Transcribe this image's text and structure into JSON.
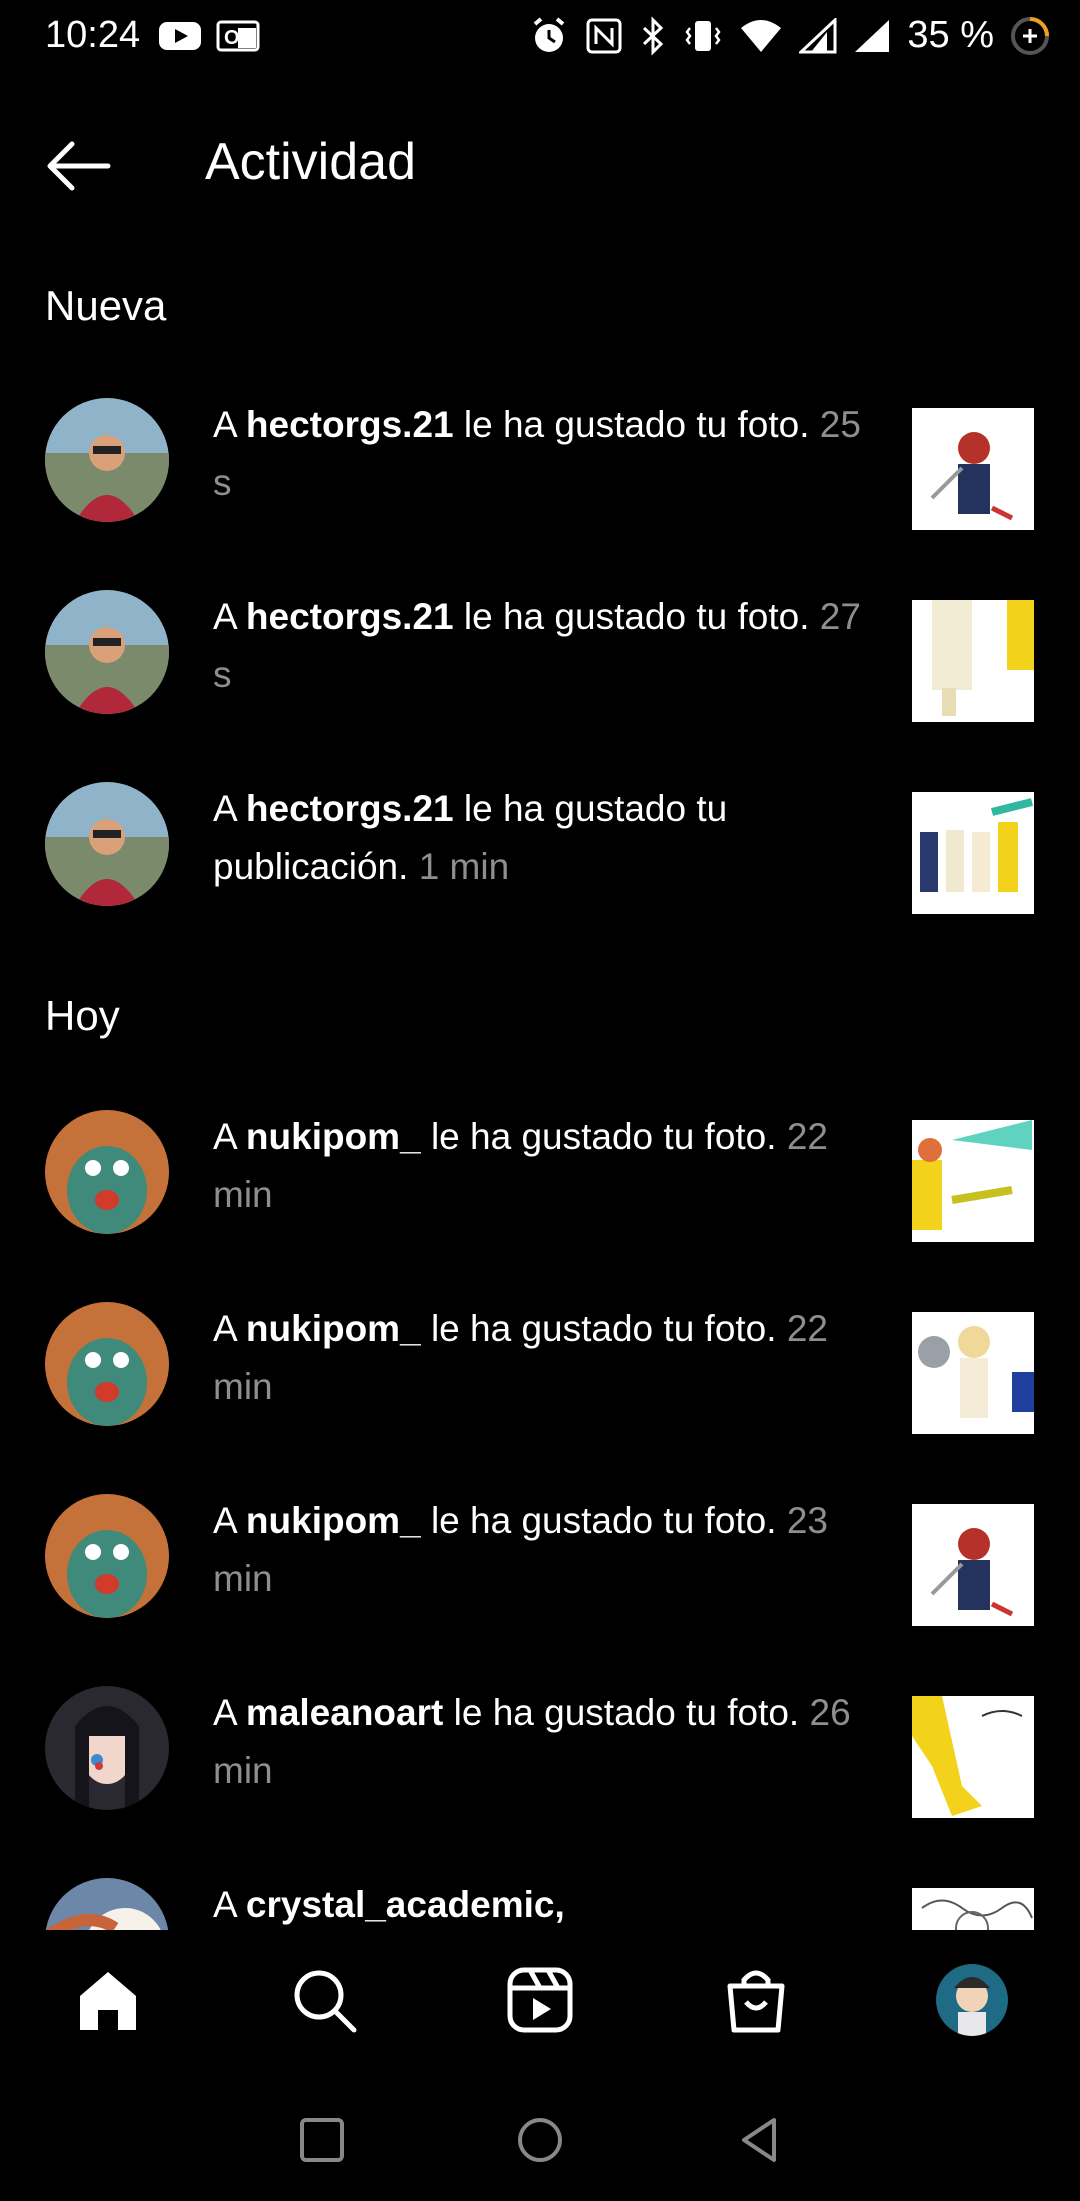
{
  "status_bar": {
    "time": "10:24",
    "battery": "35 %"
  },
  "header": {
    "title": "Actividad"
  },
  "sections": {
    "new": "Nueva",
    "today": "Hoy"
  },
  "notifications": [
    {
      "pre": "A ",
      "user": "hectorgs.21",
      "text": " le ha gustado tu foto. ",
      "time": "25 s"
    },
    {
      "pre": "A ",
      "user": "hectorgs.21",
      "text": " le ha gustado tu foto. ",
      "time": "27 s"
    },
    {
      "pre": "A ",
      "user": "hectorgs.21",
      "text": " le ha gustado tu publicación. ",
      "time": "1 min"
    },
    {
      "pre": "A ",
      "user": "nukipom_",
      "text": " le ha gustado tu foto. ",
      "time": "22 min"
    },
    {
      "pre": "A ",
      "user": "nukipom_",
      "text": " le ha gustado tu foto. ",
      "time": "22 min"
    },
    {
      "pre": "A ",
      "user": "nukipom_",
      "text": " le ha gustado tu foto. ",
      "time": "23 min"
    },
    {
      "pre": "A ",
      "user": "maleanoart",
      "text": " le ha gustado tu foto. ",
      "time": "26 min"
    },
    {
      "pre": "A ",
      "user": "crystal_academic, magae_sketches",
      "text": "",
      "time": ""
    }
  ],
  "nav": {
    "items": [
      "home-icon",
      "search-icon",
      "reels-icon",
      "shop-icon",
      "profile-avatar"
    ]
  },
  "colors": {
    "background": "#000000",
    "text": "#ffffff",
    "muted": "#8e8e8e"
  }
}
